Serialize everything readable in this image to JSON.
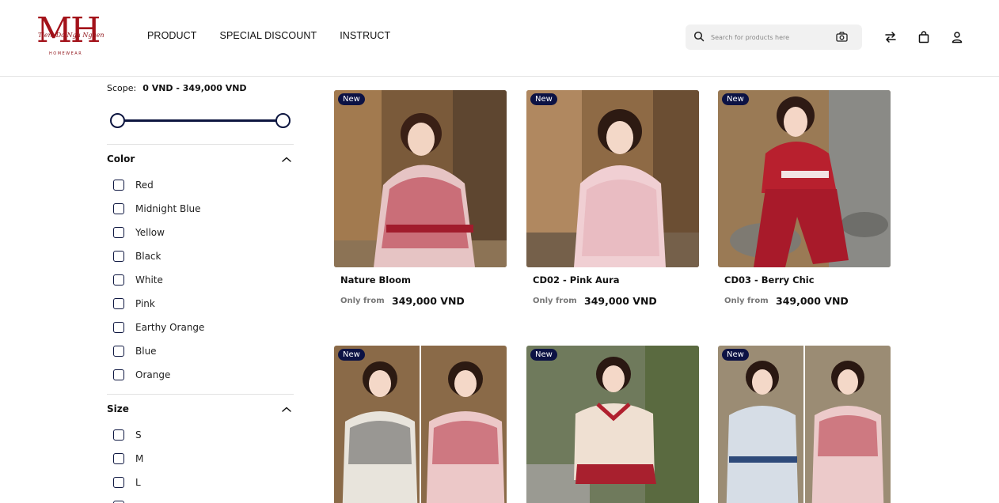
{
  "brand": {
    "logo_letters": "MH",
    "logo_script": "Tiem Do Ngu Nguen",
    "logo_subtitle": "HOMEWEAR"
  },
  "nav": {
    "items": [
      "PRODUCT",
      "SPECIAL DISCOUNT",
      "INSTRUCT"
    ]
  },
  "search": {
    "placeholder": "Search for products here"
  },
  "header_icons": [
    "search-icon",
    "camera-icon",
    "compare-icon",
    "bag-icon",
    "user-icon"
  ],
  "filters": {
    "scope_label": "Scope:",
    "scope_value": "0 VND - 349,000 VND",
    "price_range_fraction": [
      0.0,
      1.0
    ],
    "color_title": "Color",
    "colors": [
      "Red",
      "Midnight Blue",
      "Yellow",
      "Black",
      "White",
      "Pink",
      "Earthy Orange",
      "Blue",
      "Orange"
    ],
    "size_title": "Size",
    "sizes": [
      "S",
      "M",
      "L"
    ]
  },
  "products": [
    {
      "badge": "New",
      "name": "Nature Bloom",
      "from": "Only from",
      "price": "349,000 VND"
    },
    {
      "badge": "New",
      "name": "CD02 - Pink Aura",
      "from": "Only from",
      "price": "349,000 VND"
    },
    {
      "badge": "New",
      "name": "CD03 - Berry Chic",
      "from": "Only from",
      "price": "349,000 VND"
    },
    {
      "badge": "New"
    },
    {
      "badge": "New"
    },
    {
      "badge": "New"
    }
  ],
  "colors": {
    "brand_red": "#a3121a",
    "navy": "#0d1640",
    "badge_bg": "#0c1244"
  }
}
